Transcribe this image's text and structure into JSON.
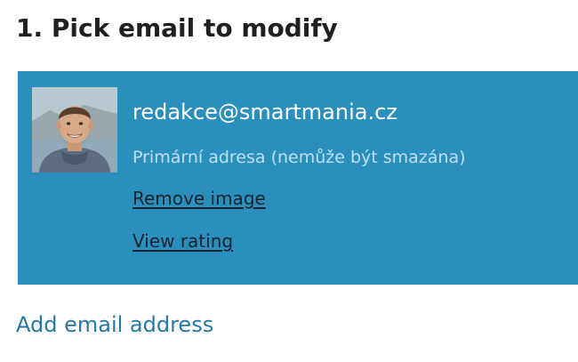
{
  "section": {
    "title": "1. Pick email to modify"
  },
  "email_card": {
    "email": "redakce@smartmania.cz",
    "status": "Primární adresa (nemůže být smazána)",
    "remove_image_label": "Remove image",
    "view_rating_label": "View rating",
    "avatar_icon": "profile-photo",
    "background_color": "#2b8fbe"
  },
  "actions": {
    "add_email_label": "Add email address"
  }
}
